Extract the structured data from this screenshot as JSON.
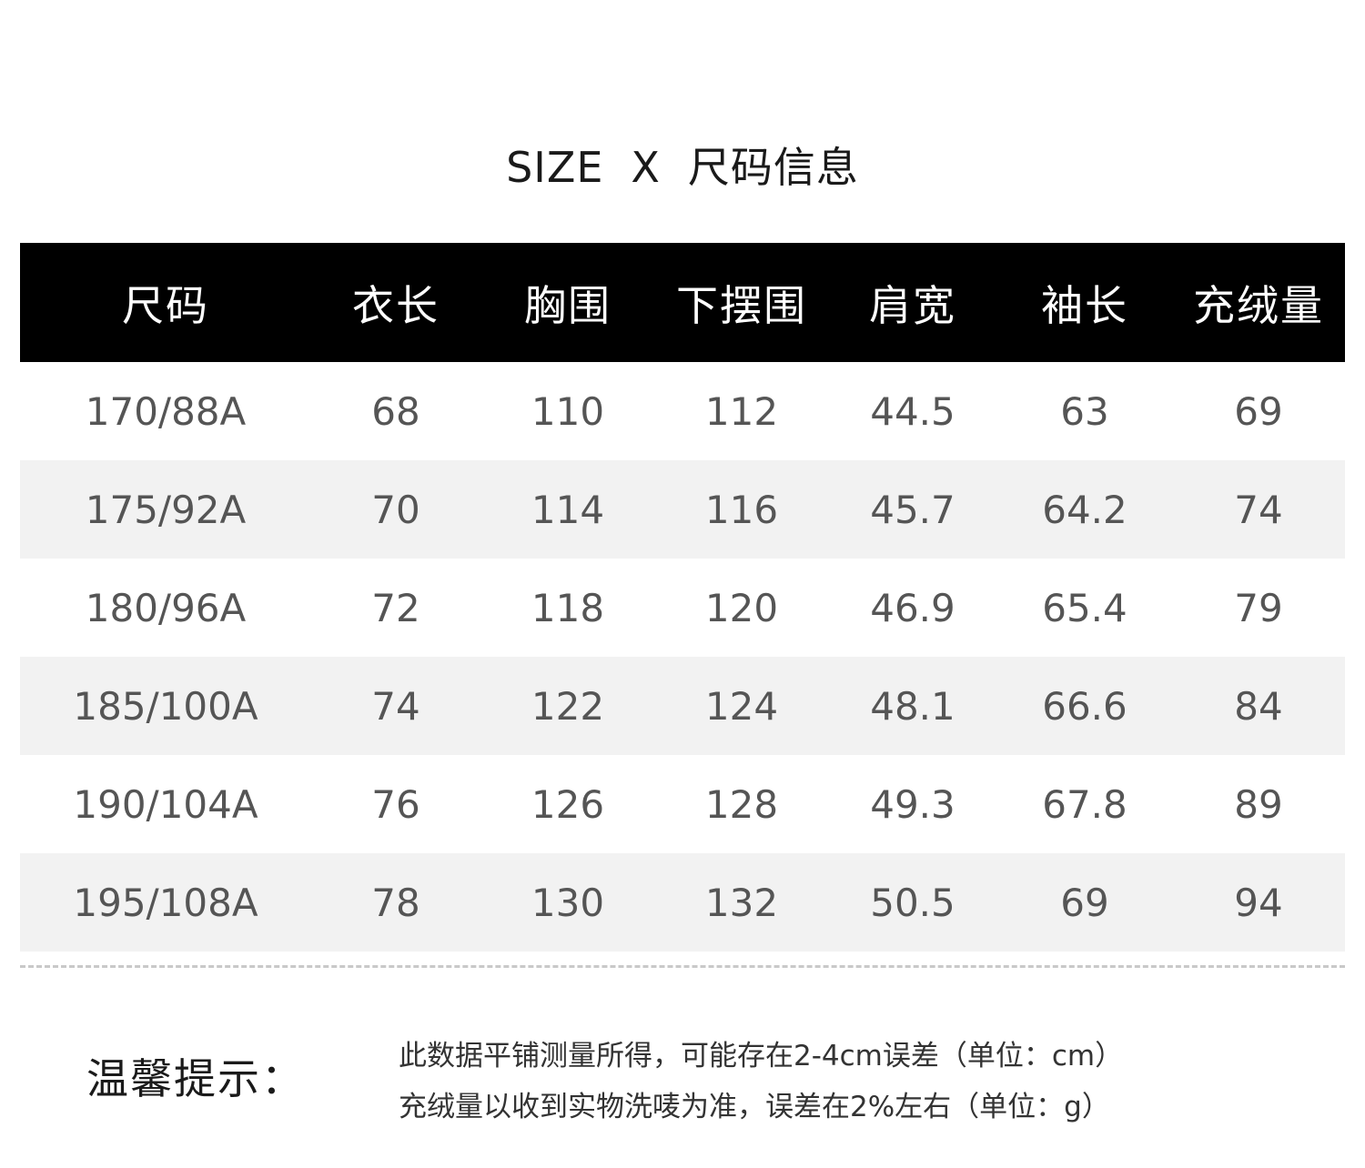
{
  "title": {
    "left": "SIZE",
    "sep": "X",
    "right": "尺码信息"
  },
  "table": {
    "headers": [
      "尺码",
      "衣长",
      "胸围",
      "下摆围",
      "肩宽",
      "袖长",
      "充绒量"
    ],
    "rows": [
      [
        "170/88A",
        "68",
        "110",
        "112",
        "44.5",
        "63",
        "69"
      ],
      [
        "175/92A",
        "70",
        "114",
        "116",
        "45.7",
        "64.2",
        "74"
      ],
      [
        "180/96A",
        "72",
        "118",
        "120",
        "46.9",
        "65.4",
        "79"
      ],
      [
        "185/100A",
        "74",
        "122",
        "124",
        "48.1",
        "66.6",
        "84"
      ],
      [
        "190/104A",
        "76",
        "126",
        "128",
        "49.3",
        "67.8",
        "89"
      ],
      [
        "195/108A",
        "78",
        "130",
        "132",
        "50.5",
        "69",
        "94"
      ]
    ]
  },
  "tips": {
    "label": "温馨提示：",
    "lines": [
      "此数据平铺测量所得，可能存在2-4cm误差（单位：cm）",
      "充绒量以收到实物洗唛为准，误差在2%左右（单位：g）"
    ]
  },
  "colors": {
    "header_bg": "#000000",
    "header_text": "#ffffff",
    "row_shade": "#f2f2f2",
    "cell_text": "#555555"
  }
}
